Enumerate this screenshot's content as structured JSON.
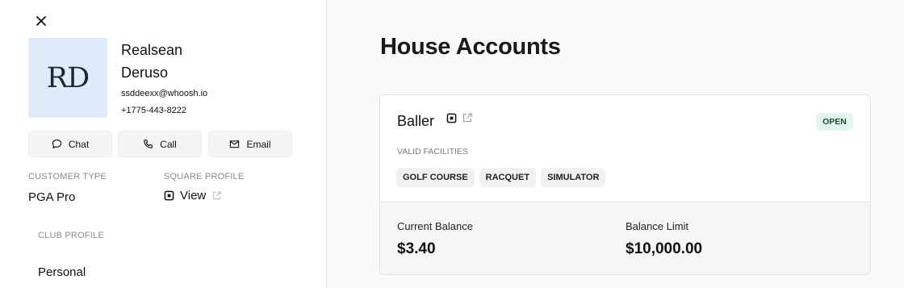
{
  "customer": {
    "initials": "RD",
    "first_name": "Realsean",
    "last_name": "Deruso",
    "email": "ssddeexx@whoosh.io",
    "phone": "+1775-443-8222",
    "avatar_bg": "#dfeafb"
  },
  "actions": {
    "chat_label": "Chat",
    "call_label": "Call",
    "email_label": "Email",
    "chat_icon": "chat-bubble-icon",
    "call_icon": "phone-icon",
    "email_icon": "envelope-icon"
  },
  "fields": {
    "customer_type_label": "CUSTOMER TYPE",
    "customer_type_value": "PGA Pro",
    "square_profile_label": "SQUARE PROFILE",
    "square_profile_link": "View",
    "club_profile_label": "CLUB PROFILE",
    "club_profile_value": "Personal"
  },
  "main": {
    "title": "House Accounts",
    "account": {
      "name": "Baller",
      "status": "OPEN",
      "status_color": "#e3f5ec",
      "facilities_label": "VALID FACILITIES",
      "facilities": [
        "GOLF COURSE",
        "RACQUET",
        "SIMULATOR"
      ],
      "current_balance_label": "Current Balance",
      "current_balance": "$3.40",
      "balance_limit_label": "Balance Limit",
      "balance_limit": "$10,000.00"
    }
  }
}
